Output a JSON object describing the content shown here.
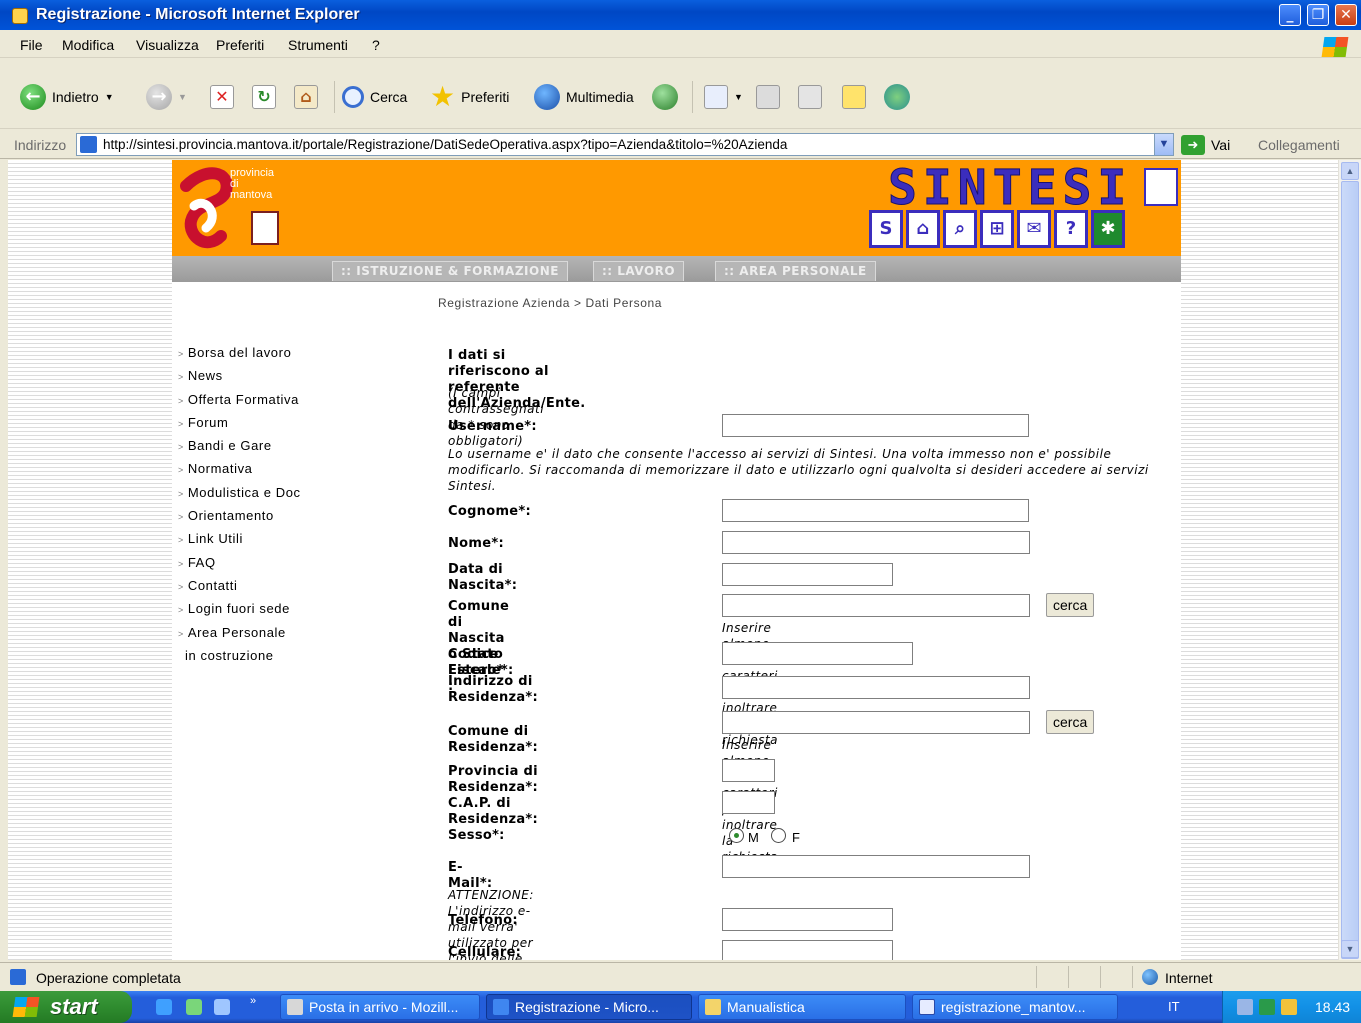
{
  "window": {
    "title": "Registrazione - Microsoft Internet Explorer"
  },
  "menu": [
    "File",
    "Modifica",
    "Visualizza",
    "Preferiti",
    "Strumenti",
    "?"
  ],
  "toolbar": {
    "back_label": "Indietro",
    "search_label": "Cerca",
    "favorites_label": "Preferiti",
    "media_label": "Multimedia"
  },
  "address": {
    "label": "Indirizzo",
    "url": "http://sintesi.provincia.mantova.it/portale/Registrazione/DatiSedeOperativa.aspx?tipo=Azienda&titolo=%20Azienda",
    "go_label": "Vai",
    "links_label": "Collegamenti"
  },
  "site": {
    "logo_text": "provincia di mantova",
    "brand": "SINTESI",
    "tabs": [
      ":: ISTRUZIONE & FORMAZIONE",
      ":: LAVORO",
      ":: AREA PERSONALE"
    ],
    "breadcrumb": "Registrazione Azienda > Dati Persona",
    "sidebar": [
      "Borsa del lavoro",
      "News",
      "Offerta Formativa",
      "Forum",
      "Bandi e Gare",
      "Normativa",
      "Modulistica e Doc",
      "Orientamento",
      "Link Utili",
      "FAQ",
      "Contatti",
      "Login fuori sede",
      "Area Personale"
    ],
    "sidebar_extra": "in costruzione"
  },
  "form": {
    "heading": "I dati si riferiscono al referente dell'Azienda/Ente.",
    "required_note": "(I campi contrassegnati da * sono obbligatori)",
    "username_label": "Username*:",
    "username_note": "Lo username e' il dato che consente l'accesso ai servizi di Sintesi. Una volta immesso non e' possibile modificarlo. Si raccomanda di memorizzare il dato e utilizzarlo ogni qualvolta si desideri accedere ai servizi Sintesi.",
    "cognome_label": "Cognome*:",
    "nome_label": "Nome*:",
    "nascita_label": "Data di Nascita*:",
    "comune_nascita_label_1": "Comune di Nascita",
    "comune_nascita_label_2": "o Stato Estero* :",
    "search_button": "cerca",
    "search_hint": "Inserire almeno tre caratteri per inoltrare la richiesta",
    "cf_label": "Codice Fiscale*:",
    "indirizzo_label_1": "Indirizzo di",
    "indirizzo_label_2": "Residenza*:",
    "comune_res_label": "Comune di Residenza*:",
    "provincia_label": "Provincia di Residenza*:",
    "cap_label": "C.A.P. di Residenza*:",
    "sesso_label": "Sesso*:",
    "sesso_m": "M",
    "sesso_f": "F",
    "sesso_selected": "M",
    "email_label": "E-Mail*:",
    "email_note": "ATTENZIONE: L'indirizzo e-mail verra' utilizzato per l'invio delle credenziali di accesso ai servizi.",
    "telefono_label": "Telefono:",
    "cellulare_label": "Cellulare:"
  },
  "status": {
    "text": "Operazione completata",
    "zone": "Internet"
  },
  "taskbar": {
    "start": "start",
    "tasks": [
      "Posta in arrivo - Mozill...",
      "Registrazione - Micro...",
      "Manualistica",
      "registrazione_mantov..."
    ],
    "active_task": "Registrazione - Micro...",
    "lang": "IT",
    "clock": "18.43"
  },
  "colors": {
    "banner": "#ff9900",
    "brand": "#3b2dbd",
    "titlebar": "#0047c4",
    "taskbar": "#245edb",
    "start": "#2f8c2f"
  }
}
